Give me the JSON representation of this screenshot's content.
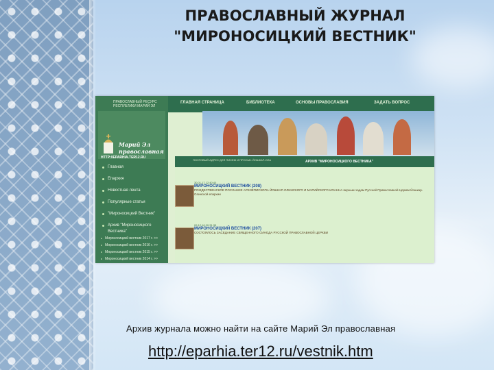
{
  "slide": {
    "title_line1": "ПРАВОСЛАВНЫЙ ЖУРНАЛ",
    "title_line2": "\"МИРОНОСИЦКИЙ ВЕСТНИК\"",
    "caption": "Архив журнала можно найти на сайте Марий Эл православная",
    "url": "http://eparhia.ter12.ru/vestnik.htm"
  },
  "site": {
    "nav": [
      "ГЛАВНАЯ СТРАНИЦА",
      "БИБЛИОТЕКА",
      "ОСНОВЫ ПРАВОСЛАВИЯ",
      "ЗАДАТЬ ВОПРОС"
    ],
    "logo_small": "ПРАВОСЛАВНЫЙ РЕСУРС РЕСПУБЛИКИ МАРИЙ ЭЛ",
    "logo_line1": "Марий Эл",
    "logo_line2": "православная",
    "site_url": "HTTP://EPARHIA.TER12.RU",
    "menu": [
      "Главная",
      "Епархия",
      "Новостная лента",
      "Популярные статьи",
      "\"Мироносицкий Вестник\"",
      "Архив \"Мироносицкого Вестника\""
    ],
    "submenu": [
      "Мироносицкий вестник 2017 г. >>",
      "Мироносицкий вестник 2016 г. >>",
      "Мироносицкий вестник 2015 г. >>",
      "Мироносицкий вестник 2014 г. >>"
    ],
    "info_text": "ПОЧТОВЫЙ АДРЕС ДЛЯ ПИСЕМ И ПРОСЬБ: ЙОШКАР-ОЛА",
    "archive_title": "АРХИВ \"МИРОНОСИЦКОГО ВЕСТНИКА\"",
    "news": [
      {
        "date": "30.01.17 12:40:40",
        "head": "МИРОНОСИЦКИЙ ВЕСТНИК (208)",
        "text": "РОЖДЕСТВЕНСКОЕ ПОСЛАНИЕ АРХИЕПИСКОПА ЙОШКАР-ОЛИНСКОГО И МАРИЙСКОГО ИОАННА верным чадам Русской Православной Церкви Йошкар-Олинской епархии"
      },
      {
        "date": "09.12.16 00:31:35",
        "head": "МИРОНОСИЦКИЙ ВЕСТНИК (207)",
        "text": "СОСТОЯЛОСЬ ЗАСЕДАНИЕ СВЯЩЕННОГО СИНОДА РУССКОЙ ПРАВОСЛАВНОЙ ЦЕРКВИ"
      }
    ]
  },
  "colors": {
    "site_green": "#2e6e4e",
    "panel_green": "#3d7b54",
    "content_bg": "#dcf0cf",
    "link_blue": "#1f4fa0"
  }
}
